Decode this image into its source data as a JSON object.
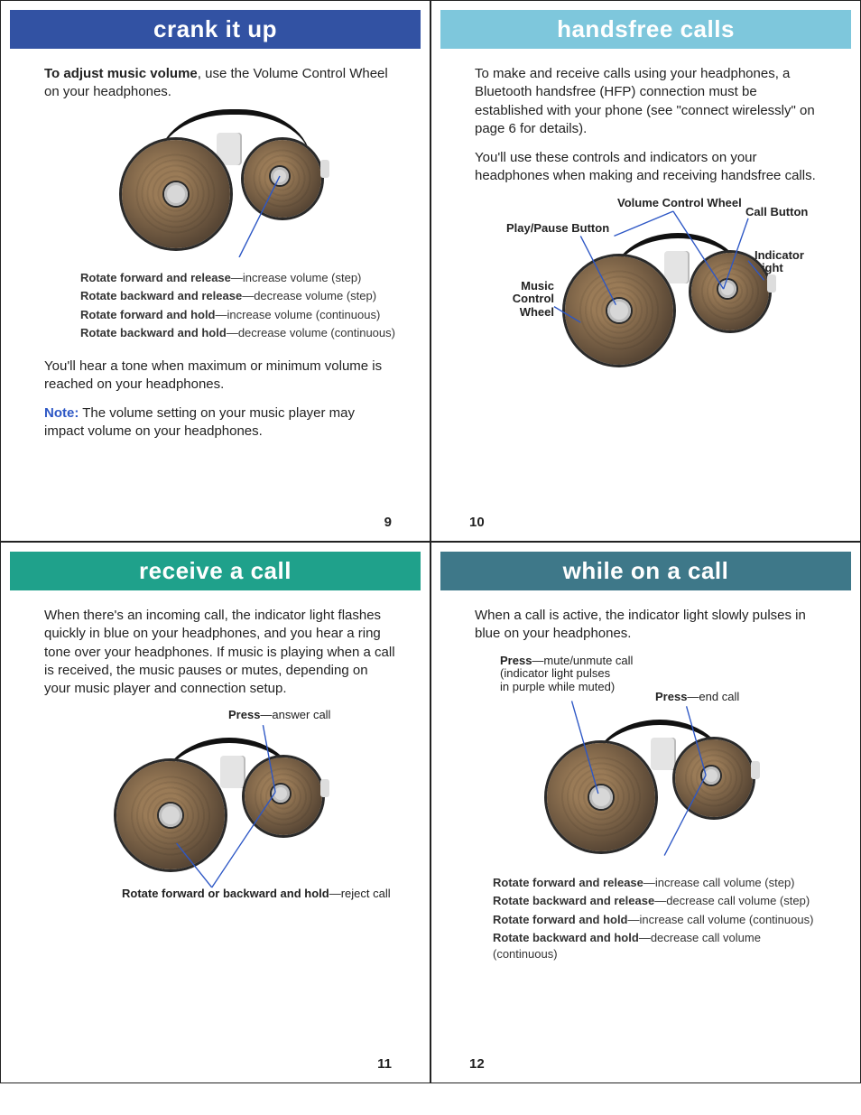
{
  "pages": {
    "p9": {
      "title": "crank it up",
      "intro_bold": "To adjust music volume",
      "intro_rest": ", use the Volume Control Wheel on your headphones.",
      "captions": [
        {
          "bold": "Rotate forward and release",
          "rest": "—increase volume (step)"
        },
        {
          "bold": "Rotate backward and release",
          "rest": "—decrease volume (step)"
        },
        {
          "bt": "",
          "bold": "Rotate forward and hold",
          "rest": "—increase volume (continuous)"
        },
        {
          "bold": "Rotate backward and hold",
          "rest": "—decrease volume (continuous)"
        }
      ],
      "para_tone": "You'll hear a tone when maximum or minimum volume is reached on your headphones.",
      "note_label": "Note:",
      "note_text": " The volume setting on your music player may impact volume on your headphones.",
      "page": "9"
    },
    "p10": {
      "title": "handsfree calls",
      "para1": "To make and receive calls using your headphones, a Bluetooth handsfree (HFP) connection must be established with your phone (see \"connect wirelessly\" on page 6 for details).",
      "para2": "You'll use these controls and indicators on your headphones when making and receiving handsfree calls.",
      "labels": {
        "vcw": "Volume Control Wheel",
        "play": "Play/Pause Button",
        "call": "Call Button",
        "ind": "Indicator Light",
        "mcw1": "Music",
        "mcw2": "Control",
        "mcw3": "Wheel"
      },
      "page": "10"
    },
    "p11": {
      "title": "receive a call",
      "para": "When there's an incoming call, the indicator light flashes quickly in blue on your headphones, and you hear a  ring tone over your headphones. If music is playing when a call is received, the music pauses or mutes, depending on your music player and connection setup.",
      "ann_press_bold": "Press",
      "ann_press_rest": "—answer call",
      "ann_hold_bold": "Rotate forward or backward and hold",
      "ann_hold_rest": "—reject call",
      "page": "11"
    },
    "p12": {
      "title": "while on a call",
      "para": "When a call is active, the indicator light slowly pulses in blue on your headphones.",
      "ann_mute_bold": "Press",
      "ann_mute_l1": "—mute/unmute call",
      "ann_mute_l2": "(indicator light pulses",
      "ann_mute_l3": "in purple while muted)",
      "ann_end_bold": "Press",
      "ann_end_rest": "—end call",
      "captions": [
        {
          "bold": "Rotate forward and release",
          "rest": "—increase call volume (step)"
        },
        {
          "bold": "Rotate backward and release",
          "rest": "—decrease call volume (step)"
        },
        {
          "bold": "Rotate forward and hold",
          "rest": "—increase call volume (continuous)"
        },
        {
          "bold": "Rotate backward and hold",
          "rest": "—decrease call volume (continuous)"
        }
      ],
      "page": "12"
    }
  }
}
